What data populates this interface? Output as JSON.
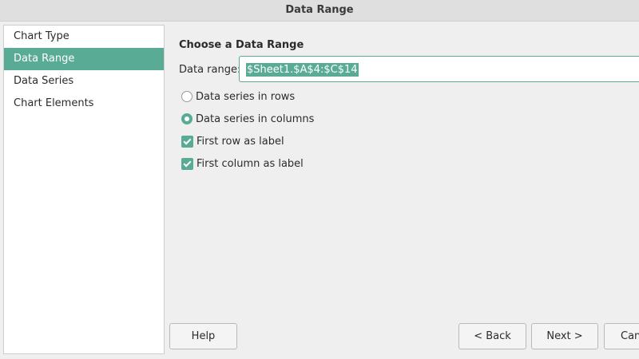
{
  "window": {
    "title": "Data Range"
  },
  "sidebar": {
    "items": [
      {
        "label": "Chart Type",
        "selected": false
      },
      {
        "label": "Data Range",
        "selected": true
      },
      {
        "label": "Data Series",
        "selected": false
      },
      {
        "label": "Chart Elements",
        "selected": false
      }
    ]
  },
  "main": {
    "section_title": "Choose a Data Range",
    "range_label": "Data range:",
    "range_value": "$Sheet1.$A$4:$C$14",
    "options": {
      "series_in_rows": {
        "label": "Data series in rows",
        "checked": false
      },
      "series_in_columns": {
        "label": "Data series in columns",
        "checked": true
      },
      "first_row_label": {
        "label": "First row as label",
        "checked": true
      },
      "first_column_label": {
        "label": "First column as label",
        "checked": true
      }
    }
  },
  "buttons": {
    "help": "Help",
    "back": "< Back",
    "next": "Next >",
    "cancel": "Can"
  },
  "colors": {
    "accent": "#59ab95",
    "background": "#efefef",
    "titlebar": "#dfdfdf"
  }
}
